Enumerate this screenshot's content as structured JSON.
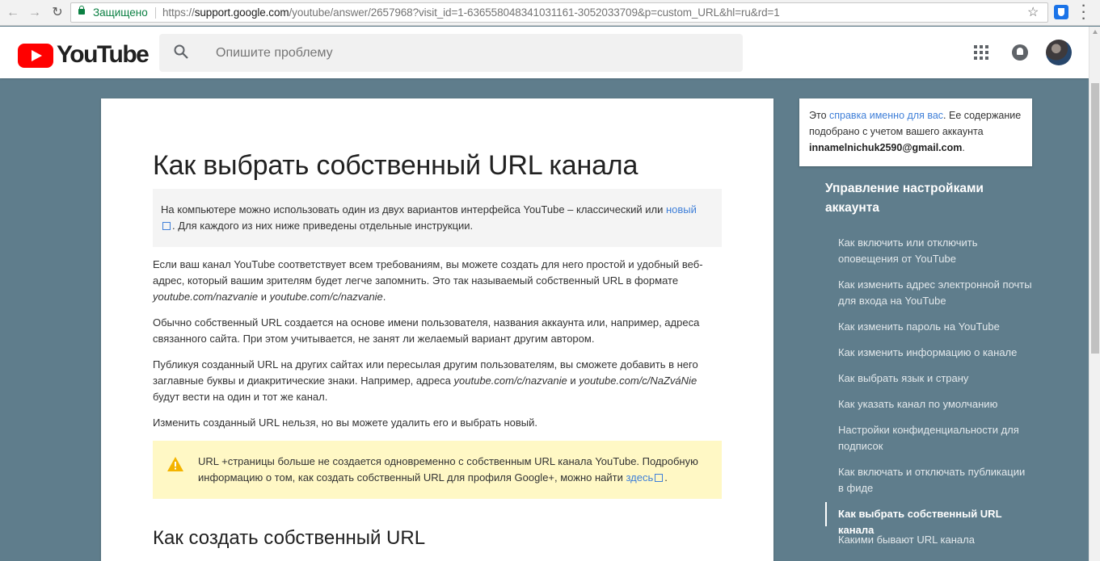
{
  "browser": {
    "back_icon": "arrow-left",
    "forward_icon": "arrow-right",
    "reload_icon": "reload",
    "secure_label": "Защищено",
    "url_scheme": "https://",
    "url_host": "support.google.com",
    "url_path": "/youtube/answer/2657968?visit_id=1-636558048341031161-3052033709&p=custom_URL&hl=ru&rd=1",
    "bookmark_icon": "star",
    "extension_icon": "shield"
  },
  "header": {
    "logo_text": "YouTube",
    "search_placeholder": "Опишите проблему"
  },
  "article": {
    "title": "Как выбрать собственный URL канала",
    "note": {
      "text_before": "На компьютере можно использовать один из двух вариантов интерфейса YouTube – классический или ",
      "link": "новый",
      "text_after": ". Для каждого из них ниже приведены отдельные инструкции."
    },
    "para1": {
      "text": "Если ваш канал YouTube соответствует всем требованиям, вы можете создать для него простой и удобный веб-адрес, который вашим зрителям будет легче запомнить. Это так называемый собственный URL в формате ",
      "ex1": "youtube.com/nazvanie",
      "and": " и ",
      "ex2": "youtube.com/c/nazvanie",
      "end": "."
    },
    "para2": "Обычно собственный URL создается на основе имени пользователя, названия аккаунта или, например, адреса связанного сайта. При этом учитывается, не занят ли желаемый вариант другим автором.",
    "para3": {
      "text": "Публикуя созданный URL на других сайтах или пересылая другим пользователям, вы сможете добавить в него заглавные буквы и диакритические знаки. Например, адреса ",
      "ex1": "youtube.com/c/nazvanie",
      "and": " и ",
      "ex2": "youtube.com/c/NaZváNie",
      "end": " будут вести на один и тот же канал."
    },
    "para4": "Изменить созданный URL нельзя, но вы можете удалить его и выбрать новый.",
    "warning": {
      "text_before": "URL +страницы больше не создается одновременно с собственным URL канала YouTube. Подробную информацию о том, как создать собственный URL для профиля Google+, можно найти ",
      "link": "здесь",
      "text_after": "."
    },
    "subtitle": "Как создать собственный URL"
  },
  "info": {
    "prefix": "Это ",
    "link": "справка именно для вас",
    "middle": ". Ее содержание подобрано с учетом вашего аккаунта ",
    "email": "innamelnichuk2590@gmail.com",
    "suffix": "."
  },
  "sidebar": {
    "heading": "Управление настройками аккаунта",
    "items": [
      {
        "label": "Как включить или отключить оповещения от YouTube"
      },
      {
        "label": "Как изменить адрес электронной почты для входа на YouTube"
      },
      {
        "label": "Как изменить пароль на YouTube"
      },
      {
        "label": "Как изменить информацию о канале"
      },
      {
        "label": "Как выбрать язык и страну"
      },
      {
        "label": "Как указать канал по умолчанию"
      },
      {
        "label": "Настройки конфиденциальности для подписок"
      },
      {
        "label": "Как включать и отключать публикации в фиде"
      },
      {
        "label": "Как выбрать собственный URL канала",
        "active": true
      },
      {
        "label": "Какими бывают URL канала"
      }
    ]
  },
  "colors": {
    "background": "#5f7d8c",
    "link": "#3f7fd8",
    "youtube_red": "#ff0000",
    "warning_bg": "#fff8c5",
    "secure_green": "#0b8043"
  }
}
